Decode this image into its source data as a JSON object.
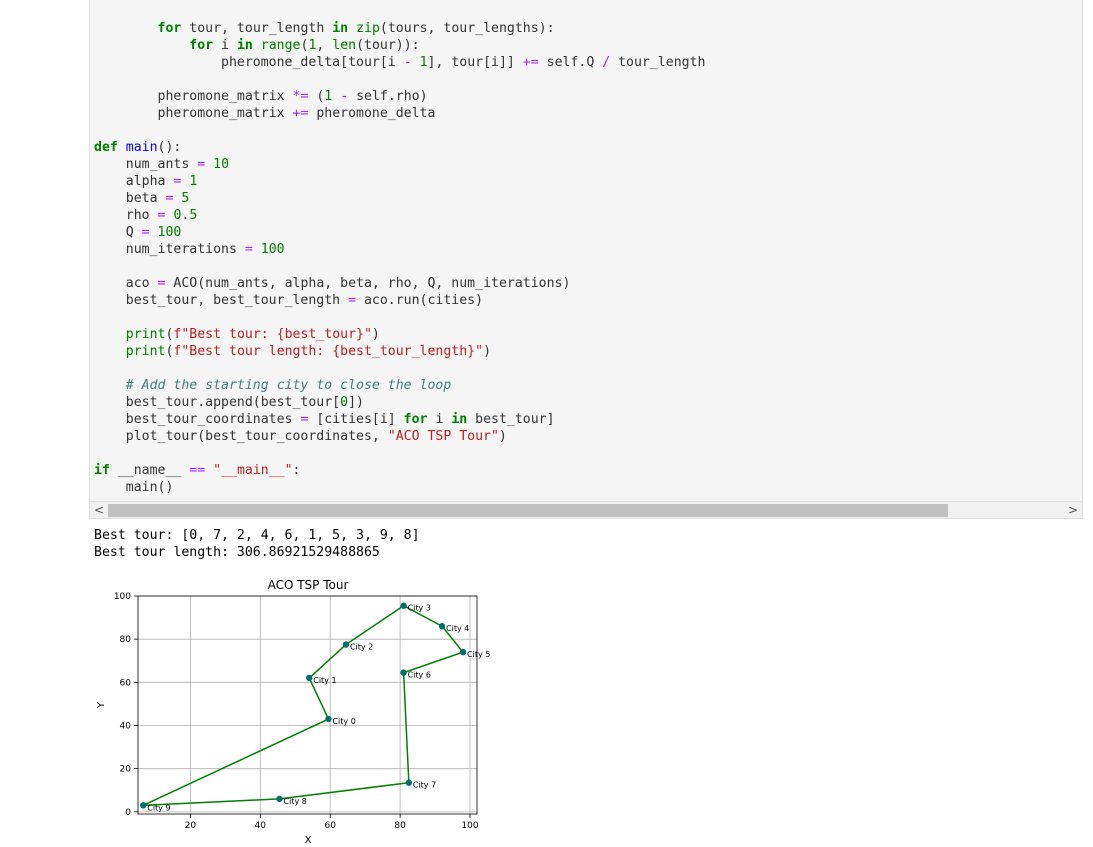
{
  "code": {
    "lines": [
      "        for tour, tour_length in zip(tours, tour_lengths):",
      "            for i in range(1, len(tour)):",
      "                pheromone_delta[tour[i - 1], tour[i]] += self.Q / tour_length",
      "",
      "        pheromone_matrix *= (1 - self.rho)",
      "        pheromone_matrix += pheromone_delta",
      "",
      "def main():",
      "    num_ants = 10",
      "    alpha = 1",
      "    beta = 5",
      "    rho = 0.5",
      "    Q = 100",
      "    num_iterations = 100",
      "",
      "    aco = ACO(num_ants, alpha, beta, rho, Q, num_iterations)",
      "    best_tour, best_tour_length = aco.run(cities)",
      "",
      "    print(f\"Best tour: {best_tour}\")",
      "    print(f\"Best tour length: {best_tour_length}\")",
      "",
      "    # Add the starting city to close the loop",
      "    best_tour.append(best_tour[0])",
      "    best_tour_coordinates = [cities[i] for i in best_tour]",
      "    plot_tour(best_tour_coordinates, \"ACO TSP Tour\")",
      "",
      "if __name__ == \"__main__\":",
      "    main()"
    ]
  },
  "scroll": {
    "left_arrow": "<",
    "right_arrow": ">"
  },
  "output": {
    "lines": [
      "Best tour: [0, 7, 2, 4, 6, 1, 5, 3, 9, 8]",
      "Best tour length: 306.86921529488865"
    ]
  },
  "colors": {
    "line": "#008000",
    "point": "#006e6e",
    "grid": "#b0b0b0"
  },
  "chart_data": {
    "type": "line",
    "title": "ACO TSP Tour",
    "xlabel": "X",
    "ylabel": "Y",
    "xlim": [
      5,
      102
    ],
    "ylim": [
      -1,
      100
    ],
    "xticks": [
      20,
      40,
      60,
      80,
      100
    ],
    "yticks": [
      0,
      20,
      40,
      60,
      80,
      100
    ],
    "grid": true,
    "points": [
      {
        "name": "City 0",
        "x": 59.5,
        "y": 43
      },
      {
        "name": "City 1",
        "x": 54,
        "y": 62
      },
      {
        "name": "City 2",
        "x": 64.5,
        "y": 77.5
      },
      {
        "name": "City 3",
        "x": 81,
        "y": 95.5
      },
      {
        "name": "City 4",
        "x": 92,
        "y": 86
      },
      {
        "name": "City 5",
        "x": 98,
        "y": 74
      },
      {
        "name": "City 6",
        "x": 81,
        "y": 64.5
      },
      {
        "name": "City 7",
        "x": 82.5,
        "y": 13.5
      },
      {
        "name": "City 8",
        "x": 45.5,
        "y": 6
      },
      {
        "name": "City 9",
        "x": 6.5,
        "y": 3
      }
    ],
    "path_order": [
      0,
      1,
      2,
      3,
      4,
      5,
      6,
      7,
      8,
      9,
      0
    ]
  }
}
